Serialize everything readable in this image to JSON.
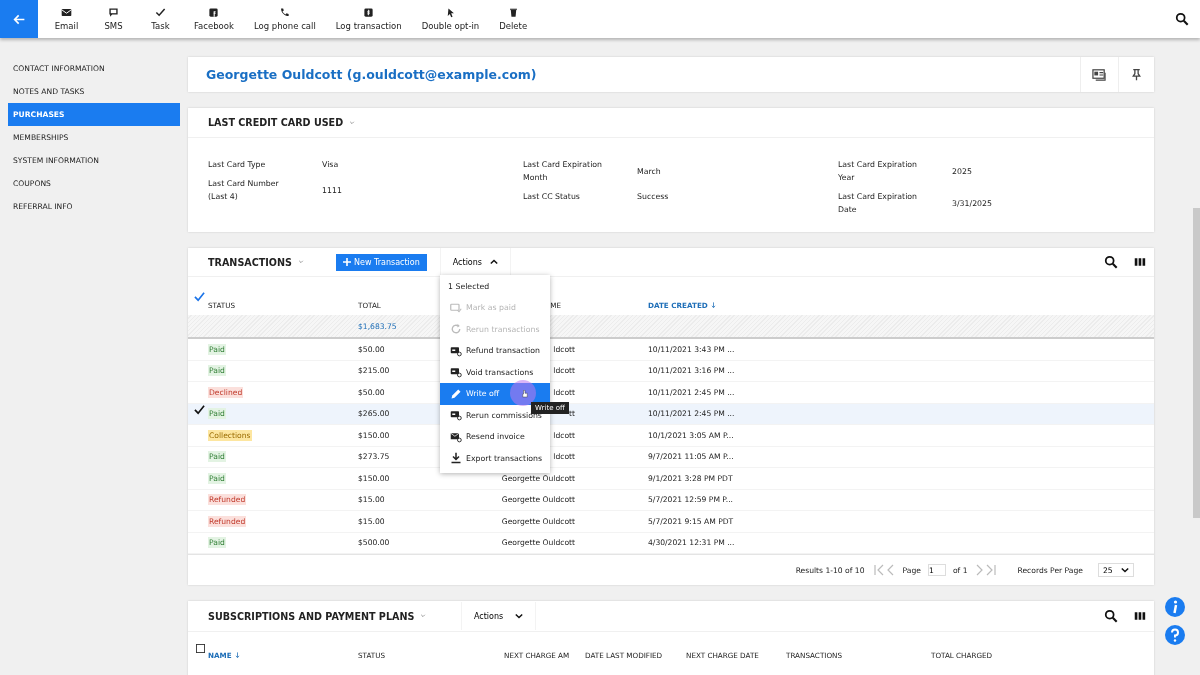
{
  "toolbar": {
    "actions": [
      {
        "label": "Email",
        "kind": "email"
      },
      {
        "label": "SMS",
        "kind": "sms"
      },
      {
        "label": "Task",
        "kind": "task"
      },
      {
        "label": "Facebook",
        "kind": "social"
      },
      {
        "label": "Log phone call",
        "kind": "phone"
      },
      {
        "label": "Log transaction",
        "kind": "money"
      },
      {
        "label": "Double opt-in",
        "kind": "pointer"
      },
      {
        "label": "Delete",
        "kind": "trash"
      }
    ]
  },
  "sidebar": {
    "items": [
      {
        "label": "CONTACT INFORMATION",
        "selected": false
      },
      {
        "label": "NOTES AND TASKS",
        "selected": false
      },
      {
        "label": "PURCHASES",
        "selected": true
      },
      {
        "label": "MEMBERSHIPS",
        "selected": false
      },
      {
        "label": "SYSTEM INFORMATION",
        "selected": false
      },
      {
        "label": "COUPONS",
        "selected": false
      },
      {
        "label": "REFERRAL INFO",
        "selected": false
      }
    ]
  },
  "contact": {
    "heading": "Georgette Ouldcott (g.ouldcott@example.com)"
  },
  "credit_card": {
    "title": "LAST CREDIT CARD USED",
    "columns": [
      [
        {
          "label": "Last Card Type",
          "value": "Visa"
        },
        {
          "label": "Last Card Number (Last 4)",
          "value": "1111"
        }
      ],
      [
        {
          "label": "Last Card Expiration Month",
          "value": "March"
        },
        {
          "label": "Last CC Status",
          "value": "Success"
        }
      ],
      [
        {
          "label": "Last Card Expiration Year",
          "value": "2025"
        },
        {
          "label": "Last Card Expiration Date",
          "value": "3/31/2025"
        }
      ]
    ]
  },
  "transactions": {
    "title": "TRANSACTIONS",
    "new_button": "New Transaction",
    "actions_button": "Actions",
    "header_checked": true,
    "columns": [
      {
        "label": "STATUS",
        "sorted": false
      },
      {
        "label": "TOTAL",
        "sorted": false
      },
      {
        "label": "ME",
        "sorted": false
      },
      {
        "label": "DATE CREATED",
        "sorted": true
      }
    ],
    "sum_total": "$1,683.75",
    "rows": [
      {
        "status": "Paid",
        "kind": "paid",
        "total": "$50.00",
        "name": "ldcott",
        "date": "10/11/2021 3:43 PM ...",
        "selected": false
      },
      {
        "status": "Paid",
        "kind": "paid",
        "total": "$215.00",
        "name": "ldcott",
        "date": "10/11/2021 3:16 PM ...",
        "selected": false
      },
      {
        "status": "Declined",
        "kind": "declined",
        "total": "$50.00",
        "name": "ldcott",
        "date": "10/11/2021 2:45 PM ...",
        "selected": false
      },
      {
        "status": "Paid",
        "kind": "paid",
        "total": "$265.00",
        "name": "tt",
        "date": "10/11/2021 2:45 PM ...",
        "selected": true
      },
      {
        "status": "Collections",
        "kind": "collections",
        "total": "$150.00",
        "name": "ldcott",
        "date": "10/1/2021 3:05 AM P...",
        "selected": false
      },
      {
        "status": "Paid",
        "kind": "paid",
        "total": "$273.75",
        "name": "ldcott",
        "date": "9/7/2021 11:05 AM P...",
        "selected": false
      },
      {
        "status": "Paid",
        "kind": "paid",
        "total": "$150.00",
        "name": "Georgette Ouldcott",
        "date": "9/1/2021 3:28 PM PDT",
        "selected": false
      },
      {
        "status": "Refunded",
        "kind": "refunded",
        "total": "$15.00",
        "name": "Georgette Ouldcott",
        "date": "5/7/2021 12:59 PM P...",
        "selected": false
      },
      {
        "status": "Refunded",
        "kind": "refunded",
        "total": "$15.00",
        "name": "Georgette Ouldcott",
        "date": "5/7/2021 9:15 AM PDT",
        "selected": false
      },
      {
        "status": "Paid",
        "kind": "paid",
        "total": "$500.00",
        "name": "Georgette Ouldcott",
        "date": "4/30/2021 12:31 PM ...",
        "selected": false
      }
    ],
    "pagination": {
      "results": "Results 1-10 of 10",
      "page_label": "Page",
      "page": "1",
      "of": "of 1",
      "per_page_label": "Records Per Page",
      "per_page": "25"
    },
    "actions_menu": {
      "header": "1 Selected",
      "items": [
        {
          "label": "Mark as paid",
          "kind": "card-check",
          "disabled": true,
          "selected": false
        },
        {
          "label": "Rerun transactions",
          "kind": "refresh",
          "disabled": true,
          "selected": false
        },
        {
          "label": "Refund transaction",
          "kind": "card-cycle",
          "disabled": false,
          "selected": false
        },
        {
          "label": "Void transactions",
          "kind": "card-cycle",
          "disabled": false,
          "selected": false
        },
        {
          "label": "Write off",
          "kind": "pencil",
          "disabled": false,
          "selected": true
        },
        {
          "label": "Rerun commissions",
          "kind": "card-cycle",
          "disabled": false,
          "selected": false
        },
        {
          "label": "Resend invoice",
          "kind": "mail-cycle",
          "disabled": false,
          "selected": false
        },
        {
          "label": "Export transactions",
          "kind": "download",
          "disabled": false,
          "selected": false
        }
      ],
      "tooltip": "Write off"
    }
  },
  "subscriptions": {
    "title": "SUBSCRIPTIONS AND PAYMENT PLANS",
    "actions_button": "Actions",
    "header_checked": false,
    "columns": [
      {
        "label": "NAME",
        "sorted": true
      },
      {
        "label": "STATUS",
        "sorted": false
      },
      {
        "label": "NEXT CHARGE AM",
        "sorted": false
      },
      {
        "label": "DATE LAST MODIFIED",
        "sorted": false
      },
      {
        "label": "NEXT CHARGE DATE",
        "sorted": false
      },
      {
        "label": "TRANSACTIONS",
        "sorted": false
      },
      {
        "label": "TOTAL CHARGED",
        "sorted": false
      }
    ]
  }
}
